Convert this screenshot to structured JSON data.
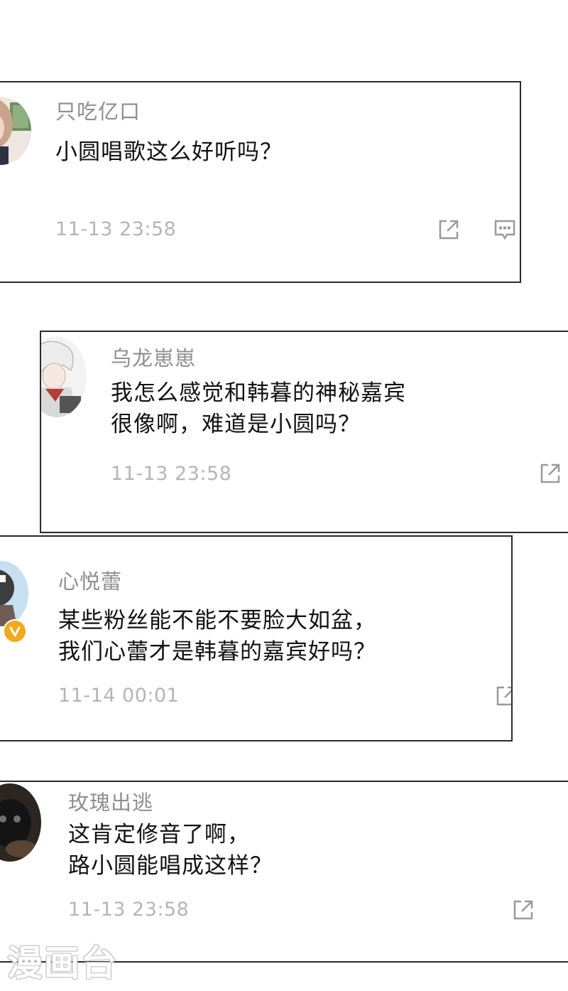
{
  "comments": [
    {
      "username": "只吃亿口",
      "lines": [
        "小圆唱歌这么好听吗？"
      ],
      "time": "11-13 23:58",
      "icons": [
        "share-icon",
        "comment-icon"
      ]
    },
    {
      "username": "乌龙崽崽",
      "lines": [
        "我怎么感觉和韩暮的神秘嘉宾",
        "很像啊，难道是小圆吗？"
      ],
      "time": "11-13 23:58",
      "icons": [
        "share-icon"
      ]
    },
    {
      "username": "心悦蕾",
      "lines": [
        "某些粉丝能不能不要脸大如盆，",
        "我们心蕾才是韩暮的嘉宾好吗？"
      ],
      "time": "11-14 00:01",
      "icons": [
        "share-icon",
        "verified-badge-icon"
      ]
    },
    {
      "username": "玫瑰出逃",
      "lines": [
        "这肯定修音了啊，",
        "路小圆能唱成这样？"
      ],
      "time": "11-13 23:58",
      "icons": [
        "share-icon"
      ]
    }
  ],
  "watermark": "漫画台",
  "colors": {
    "username": "#8f8f8f",
    "text": "#111111",
    "time": "#b5b5b5",
    "border": "#2a2a2a",
    "badge": "#f4a81d"
  }
}
